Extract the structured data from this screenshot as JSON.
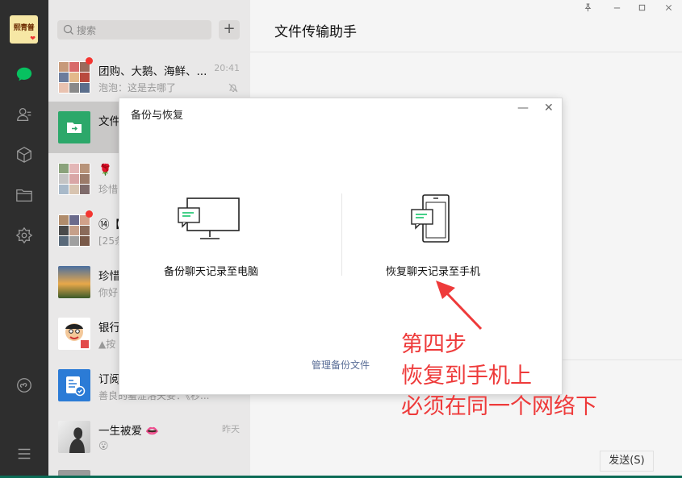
{
  "nav": {
    "avatar_text": "熙青普",
    "items": [
      "chat-icon",
      "contacts-icon",
      "favorites-icon",
      "files-icon",
      "settings-icon",
      "miniprogram-icon",
      "menu-icon"
    ]
  },
  "search": {
    "placeholder": "搜索"
  },
  "chats": [
    {
      "name": "团购、大鹅、海鲜、...",
      "preview": "泡泡：这是去哪了",
      "time": "20:41",
      "badge": true,
      "muted": true
    },
    {
      "name": "文件",
      "preview": "",
      "time": ""
    },
    {
      "name": "🌹",
      "preview": "珍惜",
      "time": ""
    },
    {
      "name": "⑭【",
      "preview": "[25条",
      "time": "",
      "badge": true
    },
    {
      "name": "珍惜",
      "preview": "你好",
      "time": ""
    },
    {
      "name": "银行",
      "preview": "▲按",
      "time": ""
    },
    {
      "name": "订阅",
      "preview": "善良的羞涩洛夫妥：《秒...",
      "time": ""
    },
    {
      "name": "一生被爱 👄",
      "preview": "😮",
      "time": "昨天"
    }
  ],
  "main": {
    "title": "文件传输助手",
    "send_label": "发送(S)",
    "window_controls": [
      "pin-icon",
      "minimize-icon",
      "maximize-icon",
      "close-icon"
    ]
  },
  "dialog": {
    "title": "备份与恢复",
    "backup_label": "备份聊天记录至电脑",
    "restore_label": "恢复聊天记录至手机",
    "manage_label": "管理备份文件",
    "min_glyph": "—",
    "close_glyph": "✕"
  },
  "annotation": {
    "lines": [
      "第四步",
      "恢复到手机上",
      "必须在同一个网络下"
    ],
    "color": "#ee3a3a"
  },
  "colors": {
    "accent": "#07c160",
    "nav_bg": "#2e2e2e",
    "list_bg": "#e9e8e8",
    "link": "#576b95"
  }
}
